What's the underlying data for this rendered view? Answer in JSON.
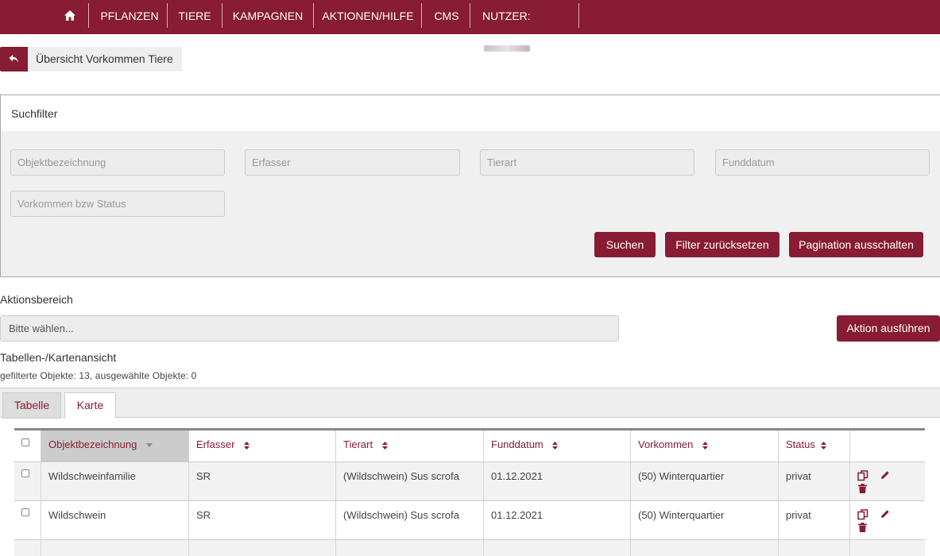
{
  "nav": {
    "home_icon": "home-icon",
    "items": [
      "PFLANZEN",
      "TIERE",
      "KAMPAGNEN",
      "AKTIONEN/HILFE",
      "CMS",
      "NUTZER:"
    ]
  },
  "back": {
    "icon": "back-arrow-icon",
    "label": "Übersicht Vorkommen Tiere"
  },
  "filter": {
    "title": "Suchfilter",
    "placeholders": {
      "objekt": "Objektbezeichnung",
      "erfasser": "Erfasser",
      "tierart": "Tierart",
      "funddatum": "Funddatum",
      "vorkommen": "Vorkommen bzw Status"
    },
    "buttons": {
      "search": "Suchen",
      "reset": "Filter zurücksetzen",
      "pagination": "Pagination ausschalten"
    }
  },
  "actions": {
    "title": "Aktionsbereich",
    "select_value": "Bitte wählen...",
    "run": "Aktion ausführen"
  },
  "view": {
    "title": "Tabellen-/Kartenansicht",
    "count": "gefilterte Objekte: 13, ausgewählte Objekte: 0",
    "tabs": [
      "Tabelle",
      "Karte"
    ]
  },
  "table": {
    "columns": [
      "Objektbezeichnung",
      "Erfasser",
      "Tierart",
      "Funddatum",
      "Vorkommen",
      "Status"
    ],
    "rows": [
      {
        "objekt": "Wildschweinfamilie",
        "erfasser": "SR",
        "tierart": "(Wildschwein) Sus scrofa",
        "funddatum": "01.12.2021",
        "vorkommen": "(50) Winterquartier",
        "status": "privat"
      },
      {
        "objekt": "Wildschwein",
        "erfasser": "SR",
        "tierart": "(Wildschwein) Sus scrofa",
        "funddatum": "01.12.2021",
        "vorkommen": "(50) Winterquartier",
        "status": "privat"
      }
    ]
  },
  "colors": {
    "brand": "#871c34",
    "panel": "#f0f0f0"
  }
}
